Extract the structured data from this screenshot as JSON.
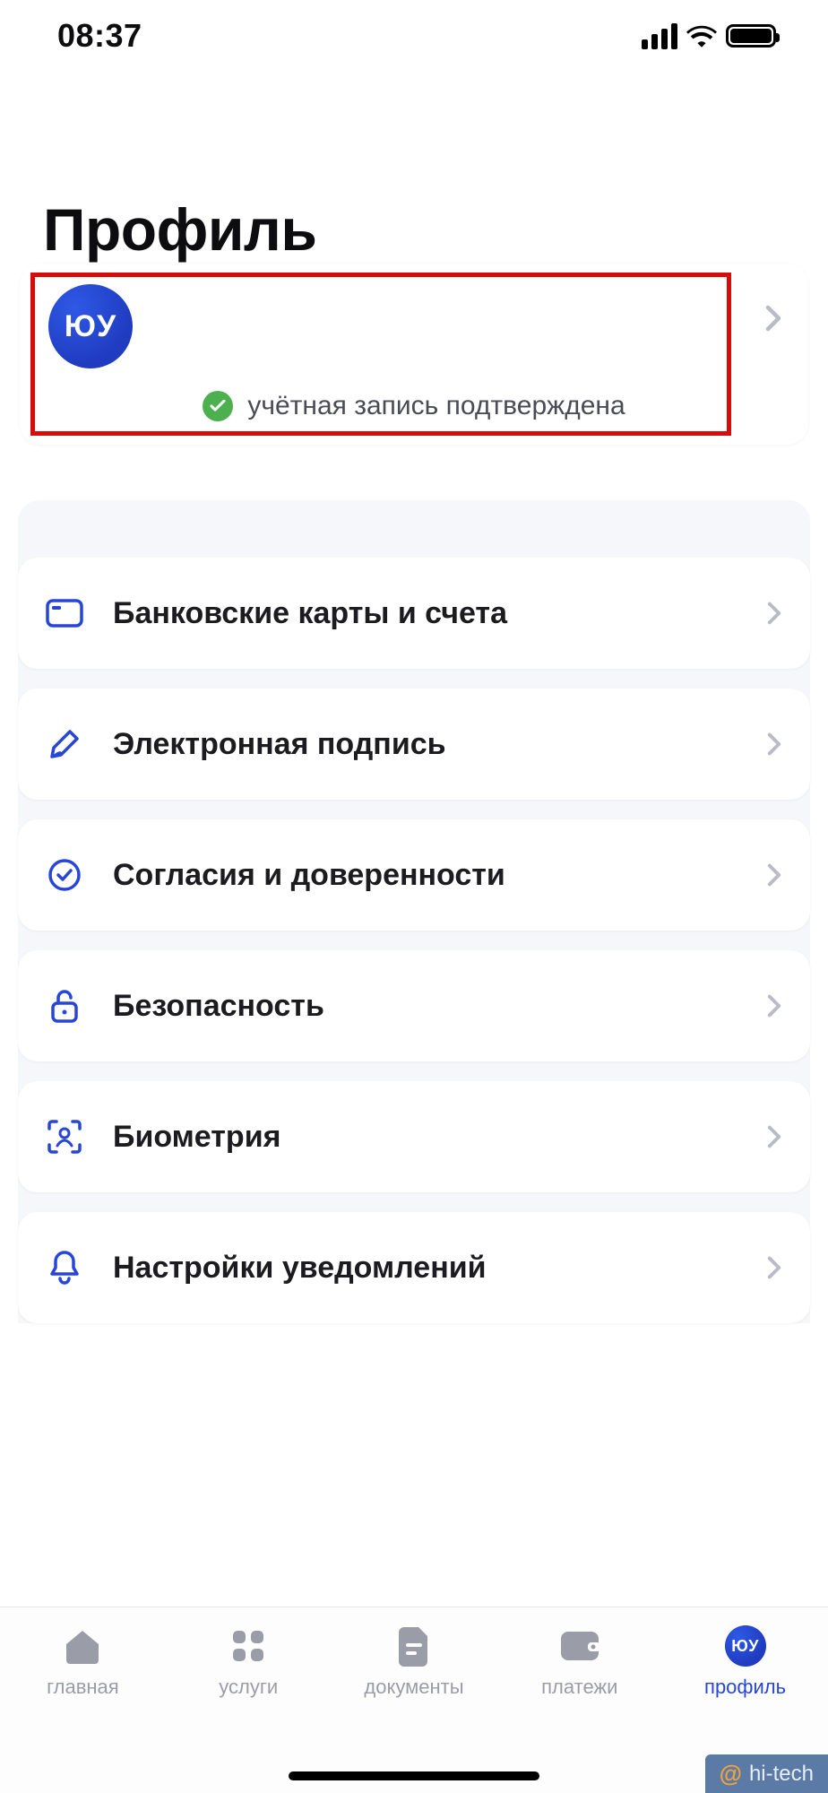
{
  "status": {
    "time": "08:37"
  },
  "page": {
    "title": "Профиль"
  },
  "profile": {
    "avatar_initials": "ЮУ",
    "verified_label": "учётная запись подтверждена"
  },
  "menu": [
    {
      "key": "cards",
      "icon": "card-icon",
      "label": "Банковские карты и счета"
    },
    {
      "key": "esign",
      "icon": "pen-icon",
      "label": "Электронная подпись"
    },
    {
      "key": "consents",
      "icon": "check-circle-icon",
      "label": "Согласия и доверенности"
    },
    {
      "key": "security",
      "icon": "lock-icon",
      "label": "Безопасность"
    },
    {
      "key": "biometry",
      "icon": "face-id-icon",
      "label": "Биометрия"
    },
    {
      "key": "notify",
      "icon": "bell-icon",
      "label": "Настройки уведомлений"
    }
  ],
  "nav": {
    "items": [
      {
        "key": "home",
        "label": "главная",
        "active": false
      },
      {
        "key": "services",
        "label": "услуги",
        "active": false
      },
      {
        "key": "docs",
        "label": "документы",
        "active": false
      },
      {
        "key": "payments",
        "label": "платежи",
        "active": false
      },
      {
        "key": "profile",
        "label": "профиль",
        "active": true,
        "avatar_initials": "ЮУ"
      }
    ]
  },
  "watermark": {
    "at": "@",
    "text": "hi-tech"
  },
  "colors": {
    "blue": "#2746d9",
    "red_highlight": "#d80b0b",
    "green_badge": "#4cb04e"
  }
}
